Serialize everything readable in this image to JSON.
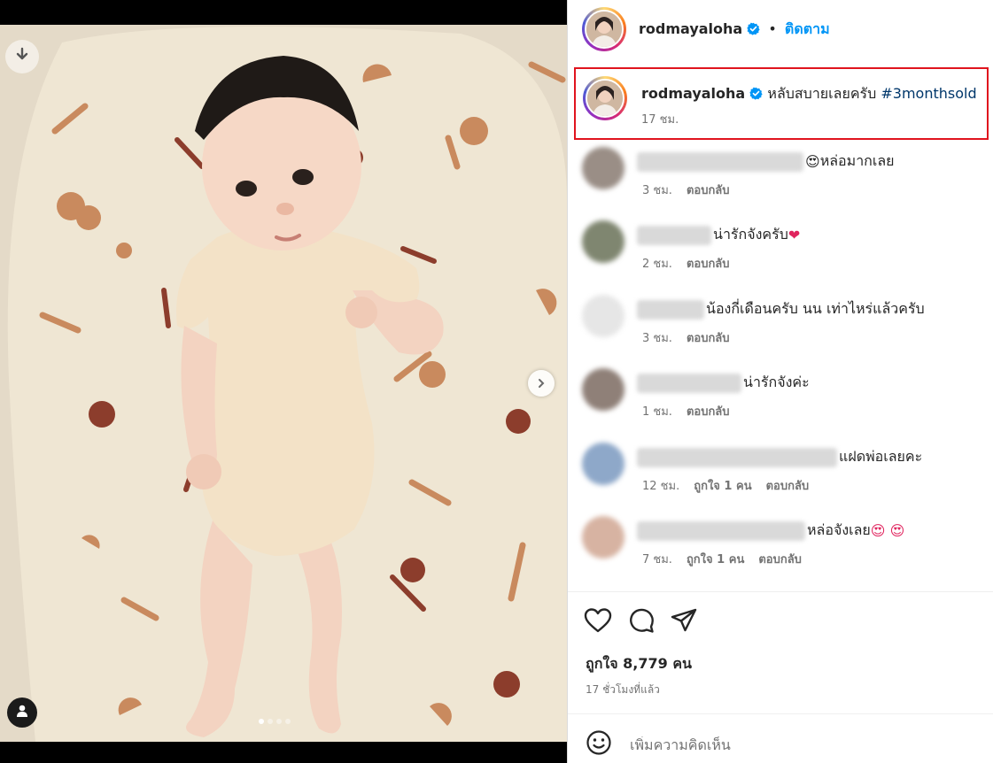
{
  "media": {
    "carousel_dots": 4,
    "active_dot": 0,
    "icons": {
      "download": "download-arrow-icon",
      "next": "chevron-right-icon",
      "tagged_user": "person-icon"
    }
  },
  "header": {
    "username": "rodmayaloha",
    "verified": true,
    "separator": "•",
    "follow_label": "ติดตาม"
  },
  "caption": {
    "username": "rodmayaloha",
    "verified": true,
    "text": "หลับสบายเลยครับ",
    "hashtag": "#3monthsold",
    "time": "17 ชม."
  },
  "comments": [
    {
      "text": "หล่อมากเลย",
      "leading_emoji": "😍",
      "trailing_emoji": "",
      "time": "3 ชม.",
      "likes": "",
      "reply": "ตอบกลับ",
      "avatar_color": "#9a8e86"
    },
    {
      "text": "น่ารักจังครับ",
      "leading_emoji": "",
      "trailing_emoji": "❤",
      "time": "2 ชม.",
      "likes": "",
      "reply": "ตอบกลับ",
      "avatar_color": "#7f8670"
    },
    {
      "text": "น้องกี่เดือนครับ นน เท่าไหร่แล้วครับ",
      "leading_emoji": "",
      "trailing_emoji": "",
      "time": "3 ชม.",
      "likes": "",
      "reply": "ตอบกลับ",
      "avatar_color": "#e6e6e6"
    },
    {
      "text": "น่ารักจังค่ะ",
      "leading_emoji": "",
      "trailing_emoji": "",
      "time": "1 ชม.",
      "likes": "",
      "reply": "ตอบกลับ",
      "avatar_color": "#8f8078"
    },
    {
      "text": "แฝดพ่อเลยคะ",
      "leading_emoji": "",
      "trailing_emoji": "",
      "time": "12 ชม.",
      "likes": "ถูกใจ 1 คน",
      "reply": "ตอบกลับ",
      "avatar_color": "#8ea8c9"
    },
    {
      "text": "หล่อจังเลย",
      "leading_emoji": "",
      "trailing_emoji": "😍 😍",
      "time": "7 ชม.",
      "likes": "ถูกใจ 1 คน",
      "reply": "ตอบกลับ",
      "avatar_color": "#d7b3a2"
    }
  ],
  "actions": {
    "like_icon": "heart-icon",
    "comment_icon": "comment-bubble-icon",
    "share_icon": "send-paper-plane-icon"
  },
  "likes_text": "ถูกใจ 8,779 คน",
  "posted_ago": "17 ชั่วโมงที่แล้ว",
  "add_comment": {
    "placeholder": "เพิ่มความคิดเห็น",
    "emoji_icon": "smiley-icon"
  },
  "colors": {
    "accent": "#0095f6",
    "highlight_border": "#e0141e",
    "hashtag": "#00376b",
    "muted": "#737373"
  }
}
